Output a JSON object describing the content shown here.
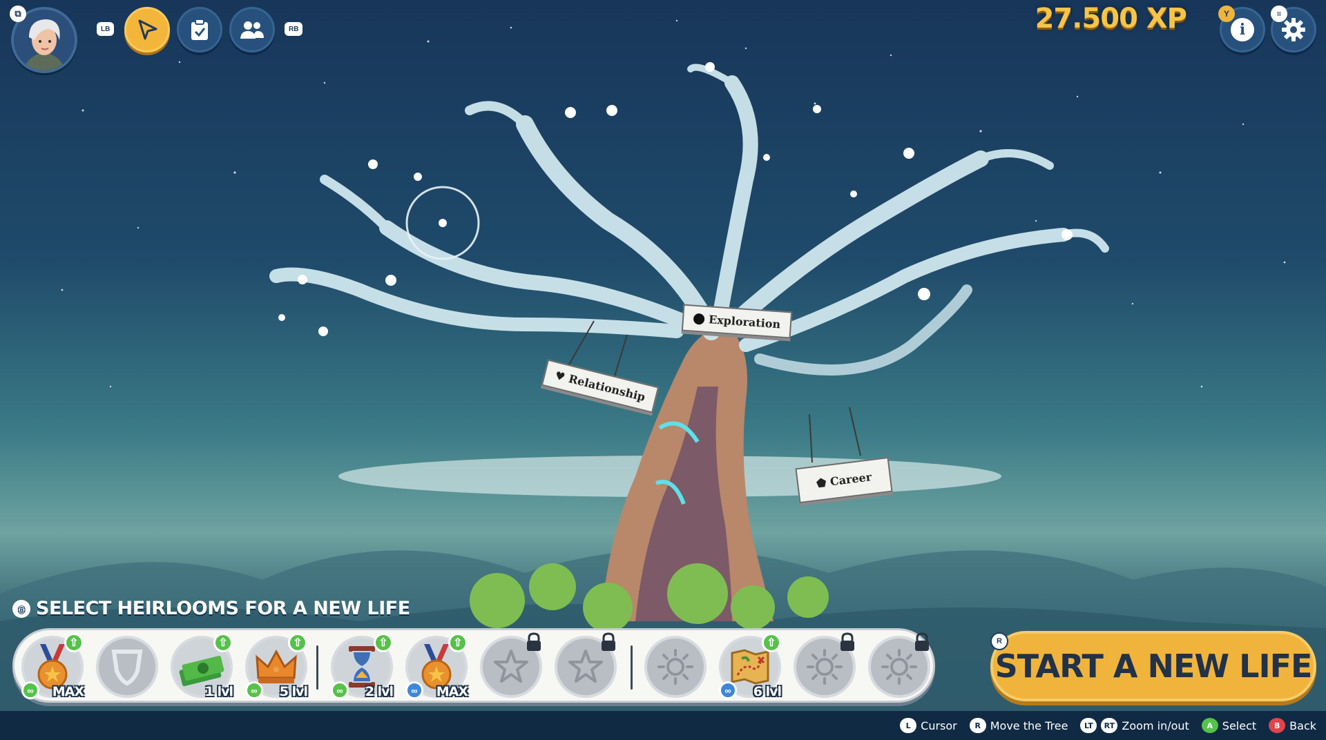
{
  "hud": {
    "corner_icon": "⧉",
    "lb_label": "LB",
    "rb_label": "RB",
    "xp_text": "27.500 XP",
    "y_badge": "Y",
    "menu_badge": "≡",
    "info_glyph": "i",
    "tabs": [
      {
        "name": "cursor-tab",
        "icon": "cursor-arrow-icon",
        "active": true
      },
      {
        "name": "tasks-tab",
        "icon": "clipboard-check-icon",
        "active": false
      },
      {
        "name": "family-tab",
        "icon": "people-icon",
        "active": false
      }
    ]
  },
  "tree": {
    "signs": [
      {
        "label": "Exploration",
        "icon": "circle-icon"
      },
      {
        "label": "Relationship",
        "icon": "heart-icon"
      },
      {
        "label": "Career",
        "icon": "pentagon-icon"
      }
    ]
  },
  "heirlooms": {
    "title": "SELECT HEIRLOOMS FOR A NEW LIFE",
    "slots": [
      {
        "icon": "medal-icon",
        "level": "MAX",
        "upgrade": true,
        "link": "green",
        "locked": false
      },
      {
        "icon": "empty-shield-icon",
        "level": "",
        "upgrade": false,
        "link": "",
        "locked": false
      },
      {
        "icon": "cash-stack-icon",
        "level": "1 lvl",
        "upgrade": true,
        "link": "",
        "locked": false
      },
      {
        "icon": "crown-icon",
        "level": "5 lvl",
        "upgrade": true,
        "link": "green",
        "locked": false
      },
      {
        "icon": "hourglass-icon",
        "level": "2 lvl",
        "upgrade": true,
        "link": "green",
        "locked": false
      },
      {
        "icon": "medal-icon",
        "level": "MAX",
        "upgrade": true,
        "link": "blue",
        "locked": false
      },
      {
        "icon": "star-icon",
        "level": "",
        "upgrade": false,
        "link": "",
        "locked": true
      },
      {
        "icon": "star-icon",
        "level": "",
        "upgrade": false,
        "link": "",
        "locked": true
      },
      {
        "icon": "sun-icon",
        "level": "",
        "upgrade": false,
        "link": "",
        "locked": false
      },
      {
        "icon": "treasure-map-icon",
        "level": "6 lvl",
        "upgrade": true,
        "link": "blue",
        "locked": false
      },
      {
        "icon": "sun-icon",
        "level": "",
        "upgrade": false,
        "link": "",
        "locked": true
      },
      {
        "icon": "sun-icon",
        "level": "",
        "upgrade": false,
        "link": "",
        "locked": true
      }
    ]
  },
  "start_button": {
    "label": "START A NEW LIFE",
    "badge": "R"
  },
  "controls": [
    {
      "key": "L",
      "label": "Cursor"
    },
    {
      "key": "R",
      "label": "Move the Tree"
    },
    {
      "key": "LT",
      "label": ""
    },
    {
      "key": "RT",
      "label": "Zoom in/out"
    },
    {
      "key": "A",
      "label": "Select"
    },
    {
      "key": "B",
      "label": "Back"
    }
  ],
  "colors": {
    "accent_gold": "#f0b43c",
    "xp_gold": "#f6c548",
    "upgrade_green": "#57c14a",
    "link_blue": "#3d86d8",
    "back_red": "#e0444d"
  }
}
